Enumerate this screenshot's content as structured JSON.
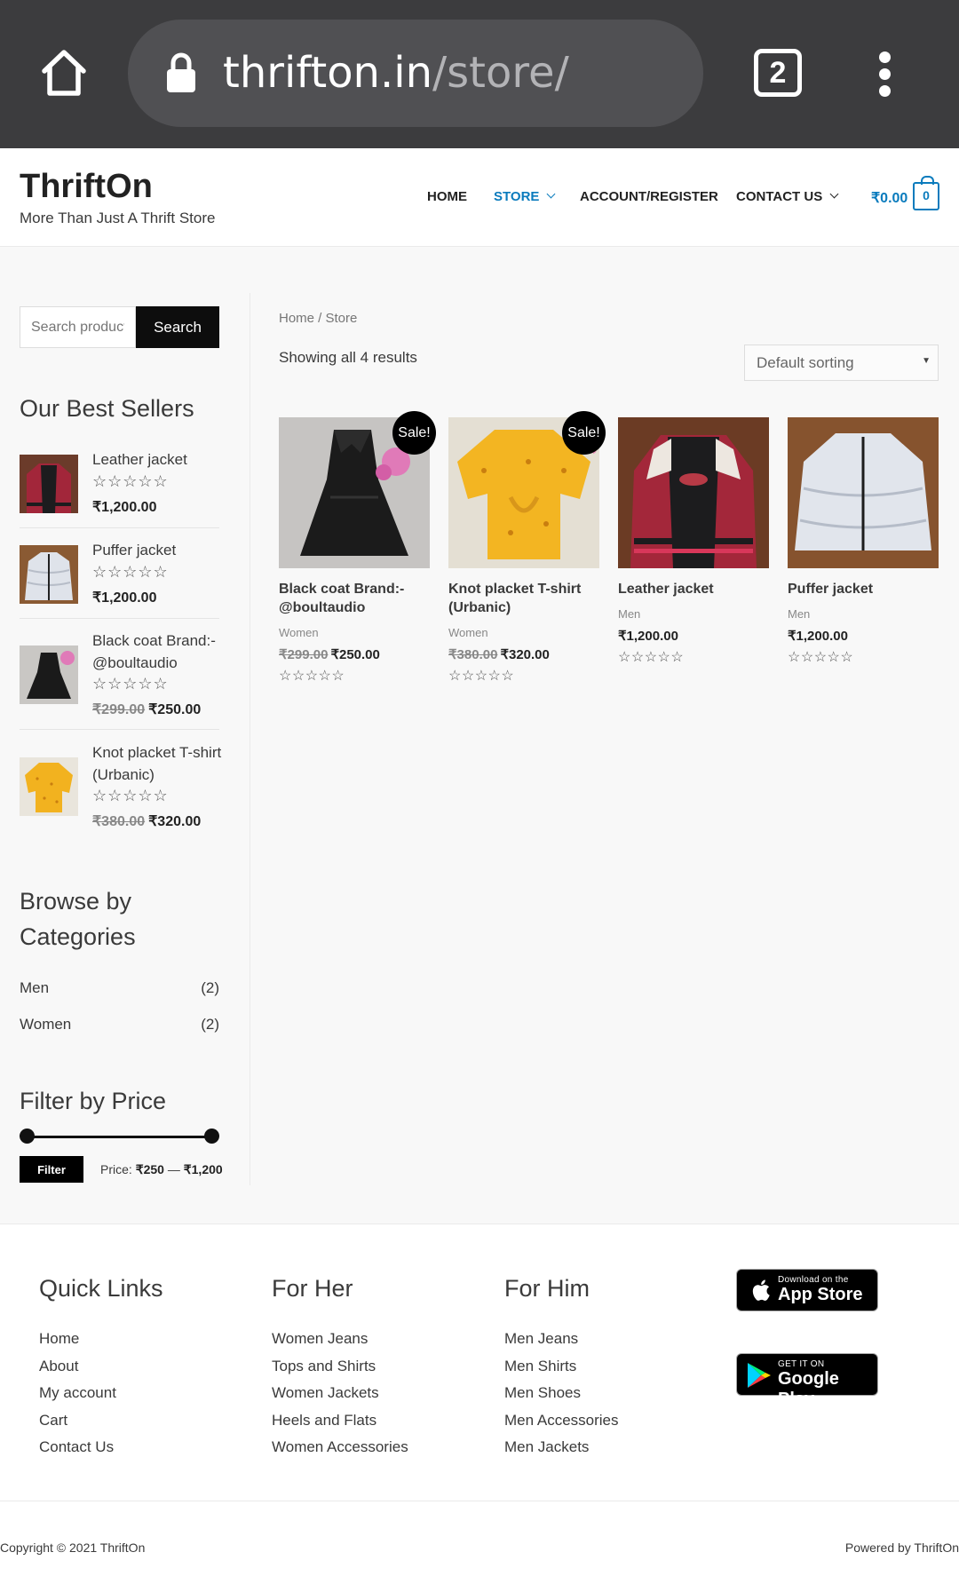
{
  "browser": {
    "url_host": "thrifton.in",
    "url_path": "/store/",
    "tab_count": "2"
  },
  "header": {
    "logo": "ThriftOn",
    "tagline": "More Than Just A Thrift Store",
    "nav": [
      "HOME",
      "STORE",
      "ACCOUNT/REGISTER",
      "CONTACT US"
    ],
    "cart_total": "₹0.00",
    "cart_count": "0",
    "accent_color": "#0a7bbd"
  },
  "sidebar": {
    "search_placeholder": "Search products…",
    "search_button": "Search",
    "best_sellers_title": "Our Best Sellers",
    "best_sellers": [
      {
        "name": "Leather jacket",
        "stars": "☆☆☆☆☆",
        "old_price": "",
        "price": "₹1,200.00"
      },
      {
        "name": "Puffer jacket",
        "stars": "☆☆☆☆☆",
        "old_price": "",
        "price": "₹1,200.00"
      },
      {
        "name": "Black coat Brand:- @boultaudio",
        "stars": "☆☆☆☆☆",
        "old_price": "₹299.00",
        "price": "₹250.00"
      },
      {
        "name": "Knot placket T-shirt (Urbanic)",
        "stars": "☆☆☆☆☆",
        "old_price": "₹380.00",
        "price": "₹320.00"
      }
    ],
    "categories_title": "Browse by Categories",
    "categories": [
      {
        "name": "Men",
        "count": "(2)"
      },
      {
        "name": "Women",
        "count": "(2)"
      }
    ],
    "price_filter_title": "Filter by Price",
    "filter_button": "Filter",
    "price_prefix": "Price: ",
    "price_min": "₹250",
    "price_sep": " — ",
    "price_max": "₹1,200"
  },
  "main": {
    "breadcrumb": "Home / Store",
    "result_count": "Showing all 4 results",
    "sort_selected": "Default sorting",
    "sale_badge": "Sale!",
    "products": [
      {
        "name": "Black coat Brand:- @boultaudio",
        "category": "Women",
        "old_price": "₹299.00",
        "price": "₹250.00",
        "stars": "☆☆☆☆☆",
        "on_sale": true
      },
      {
        "name": "Knot placket T-shirt (Urbanic)",
        "category": "Women",
        "old_price": "₹380.00",
        "price": "₹320.00",
        "stars": "☆☆☆☆☆",
        "on_sale": true
      },
      {
        "name": "Leather jacket",
        "category": "Men",
        "old_price": "",
        "price": "₹1,200.00",
        "stars": "☆☆☆☆☆",
        "on_sale": false
      },
      {
        "name": "Puffer jacket",
        "category": "Men",
        "old_price": "",
        "price": "₹1,200.00",
        "stars": "☆☆☆☆☆",
        "on_sale": false
      }
    ]
  },
  "footer": {
    "quick_links_title": "Quick Links",
    "quick_links": [
      "Home",
      "About",
      "My account",
      "Cart",
      "Contact Us"
    ],
    "for_her_title": "For Her",
    "for_her": [
      "Women Jeans",
      "Tops and Shirts",
      "Women Jackets",
      "Heels and Flats",
      "Women Accessories"
    ],
    "for_him_title": "For Him",
    "for_him": [
      "Men Jeans",
      "Men Shirts",
      "Men Shoes",
      "Men Accessories",
      "Men Jackets"
    ],
    "app_store_small": "Download on the",
    "app_store_big": "App Store",
    "google_play_small": "GET IT ON",
    "google_play_big": "Google Play",
    "copyright": "Copyright © 2021 ThriftOn",
    "powered_by": "Powered by ThriftOn"
  }
}
